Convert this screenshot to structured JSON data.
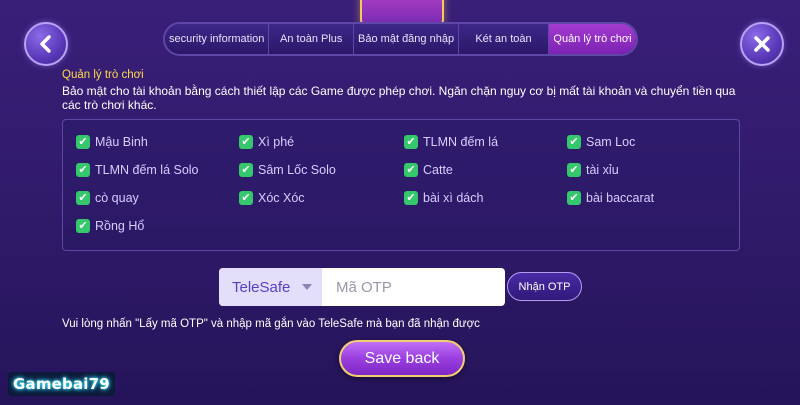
{
  "header": {
    "tabs": [
      {
        "label": "security information",
        "active": false
      },
      {
        "label": "An toàn Plus",
        "active": false
      },
      {
        "label": "Bảo mật đăng nhập",
        "active": false
      },
      {
        "label": "Két an toàn",
        "active": false
      },
      {
        "label": "Quản lý trò chơi",
        "active": true
      }
    ],
    "back_icon": "chevron-left-icon",
    "close_icon": "close-icon"
  },
  "section": {
    "title": "Quản lý trò chơi",
    "description": "Bảo mật cho tài khoản bằng cách thiết lập các Game được phép chơi. Ngăn chặn nguy cơ bị mất tài khoản và chuyển tiền qua các trò chơi khác."
  },
  "games": [
    {
      "label": "Mậu Binh",
      "checked": true
    },
    {
      "label": "Xì phé",
      "checked": true
    },
    {
      "label": "TLMN đếm lá",
      "checked": true
    },
    {
      "label": "Sam Loc",
      "checked": true
    },
    {
      "label": "TLMN đếm lá Solo",
      "checked": true
    },
    {
      "label": "Sâm Lốc Solo",
      "checked": true
    },
    {
      "label": "Catte",
      "checked": true
    },
    {
      "label": "tài xỉu",
      "checked": true
    },
    {
      "label": "cò quay",
      "checked": true
    },
    {
      "label": "Xóc Xóc",
      "checked": true
    },
    {
      "label": "bài xì dách",
      "checked": true
    },
    {
      "label": "bài baccarat",
      "checked": true
    },
    {
      "label": "Rồng Hổ",
      "checked": true
    }
  ],
  "otp": {
    "method": "TeleSafe",
    "placeholder": "Mã OTP",
    "button_label": "Nhận OTP",
    "hint": "Vui lòng nhấn \"Lấy mã OTP\" và nhập mã gắn vào TeleSafe mà bạn đã nhận được"
  },
  "save_label": "Save back",
  "brand": "Gamebai79",
  "colors": {
    "background": "#2f1a69",
    "accent": "#a43bd0",
    "check": "#34c76b",
    "title": "#ffd84a"
  }
}
